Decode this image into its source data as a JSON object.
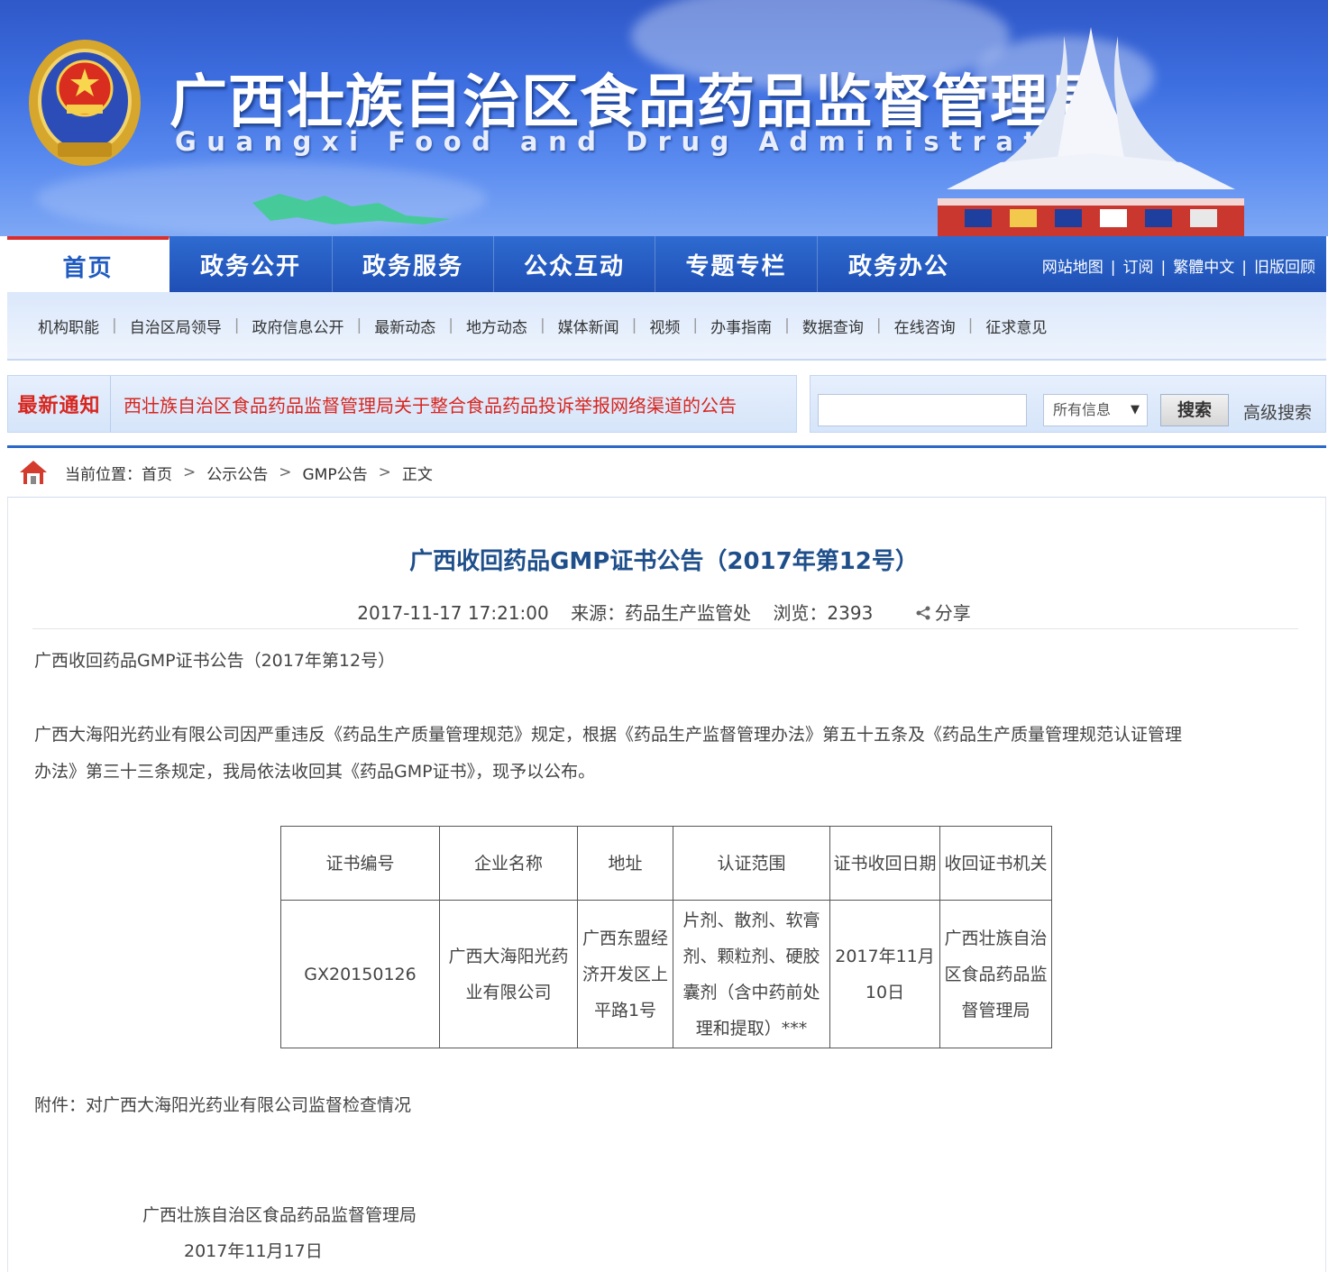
{
  "header": {
    "title_cn": "广西壮族自治区食品药品监督管理局",
    "title_en": "Guangxi Food and Drug Administration",
    "emblem_label": "食品药品监督"
  },
  "nav": {
    "items": [
      {
        "label": "首页",
        "active": true
      },
      {
        "label": "政务公开"
      },
      {
        "label": "政务服务"
      },
      {
        "label": "公众互动"
      },
      {
        "label": "专题专栏"
      },
      {
        "label": "政务办公"
      }
    ],
    "links": [
      "网站地图",
      "订阅",
      "繁體中文",
      "旧版回顾"
    ]
  },
  "subnav": [
    "机构职能",
    "自治区局领导",
    "政府信息公开",
    "最新动态",
    "地方动态",
    "媒体新闻",
    "视频",
    "办事指南",
    "数据查询",
    "在线咨询",
    "征求意见"
  ],
  "notice": {
    "label": "最新通知",
    "text": "西壮族自治区食品药品监督管理局关于整合食品药品投诉举报网络渠道的公告"
  },
  "search": {
    "input_value": "",
    "select_value": "所有信息",
    "button": "搜索",
    "advanced": "高级搜索"
  },
  "breadcrumb": {
    "prefix": "当前位置：",
    "items": [
      "首页",
      "公示公告",
      "GMP公告",
      "正文"
    ]
  },
  "article": {
    "title": "广西收回药品GMP证书公告（2017年第12号）",
    "datetime": "2017-11-17 17:21:00",
    "source": "来源：药品生产监管处",
    "views": "浏览：2393",
    "share": "分享",
    "intro": "广西收回药品GMP证书公告（2017年第12号）",
    "body_line1": "广西大海阳光药业有限公司因严重违反《药品生产质量管理规范》规定，根据《药品生产监督管理办法》第五十五条及《药品生产质量管理规范认证管理",
    "body_line2": "办法》第三十三条规定，我局依法收回其《药品GMP证书》，现予以公布。",
    "attachment": "附件：对广西大海阳光药业有限公司监督检查情况",
    "signature": "广西壮族自治区食品药品监督管理局",
    "sign_date": "2017年11月17日"
  },
  "table": {
    "headers": [
      "证书编号",
      "企业名称",
      "地址",
      "认证范围",
      "证书收回日期",
      "收回证书机关"
    ],
    "rows": [
      [
        "GX20150126",
        "广西大海阳光药业有限公司",
        "广西东盟经济开发区上平路1号",
        "片剂、散剂、软膏剂、颗粒剂、硬胶囊剂（含中药前处理和提取）***",
        "2017年11月10日",
        "广西壮族自治区食品药品监督管理局"
      ]
    ]
  },
  "colors": {
    "nav_blue": "#1f4fb5",
    "accent_red": "#d8261f",
    "title_blue": "#1f4f8a"
  }
}
